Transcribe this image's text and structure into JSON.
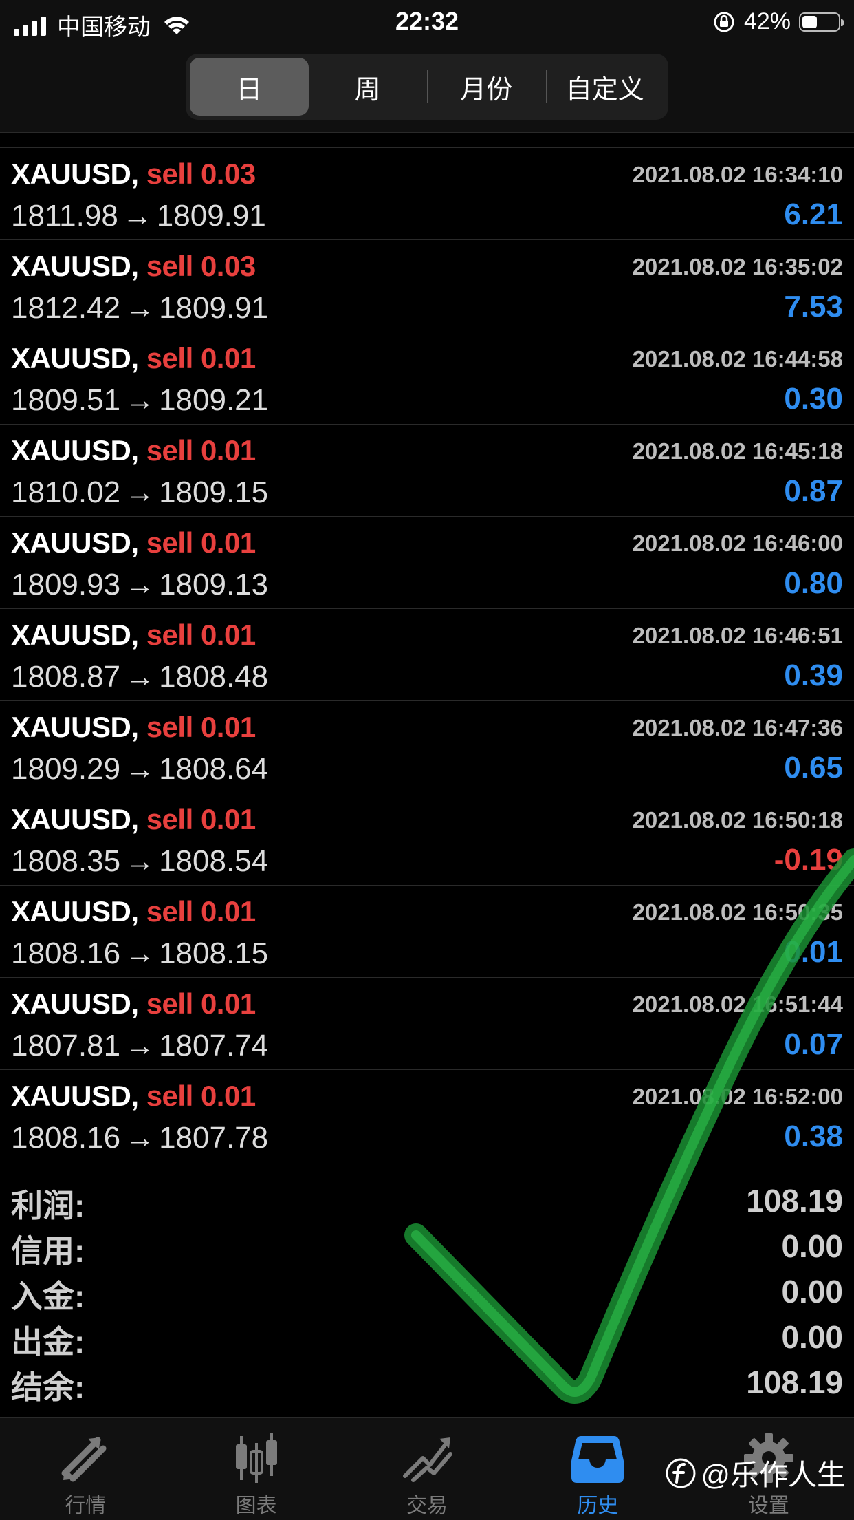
{
  "status_bar": {
    "carrier": "中国移动",
    "time": "22:32",
    "battery_percent": "42%",
    "battery_level": 0.42
  },
  "header": {
    "tabs": [
      {
        "label": "日",
        "active": true
      },
      {
        "label": "周",
        "active": false
      },
      {
        "label": "月份",
        "active": false
      },
      {
        "label": "自定义",
        "active": false
      }
    ]
  },
  "deals": [
    {
      "symbol": "XAUUSD,",
      "side": "sell",
      "volume": "0.03",
      "time": "2021.08.02 16:34:10",
      "open": "1811.98",
      "close": "1809.91",
      "profit": "6.21"
    },
    {
      "symbol": "XAUUSD,",
      "side": "sell",
      "volume": "0.03",
      "time": "2021.08.02 16:35:02",
      "open": "1812.42",
      "close": "1809.91",
      "profit": "7.53"
    },
    {
      "symbol": "XAUUSD,",
      "side": "sell",
      "volume": "0.01",
      "time": "2021.08.02 16:44:58",
      "open": "1809.51",
      "close": "1809.21",
      "profit": "0.30"
    },
    {
      "symbol": "XAUUSD,",
      "side": "sell",
      "volume": "0.01",
      "time": "2021.08.02 16:45:18",
      "open": "1810.02",
      "close": "1809.15",
      "profit": "0.87"
    },
    {
      "symbol": "XAUUSD,",
      "side": "sell",
      "volume": "0.01",
      "time": "2021.08.02 16:46:00",
      "open": "1809.93",
      "close": "1809.13",
      "profit": "0.80"
    },
    {
      "symbol": "XAUUSD,",
      "side": "sell",
      "volume": "0.01",
      "time": "2021.08.02 16:46:51",
      "open": "1808.87",
      "close": "1808.48",
      "profit": "0.39"
    },
    {
      "symbol": "XAUUSD,",
      "side": "sell",
      "volume": "0.01",
      "time": "2021.08.02 16:47:36",
      "open": "1809.29",
      "close": "1808.64",
      "profit": "0.65"
    },
    {
      "symbol": "XAUUSD,",
      "side": "sell",
      "volume": "0.01",
      "time": "2021.08.02 16:50:18",
      "open": "1808.35",
      "close": "1808.54",
      "profit": "-0.19"
    },
    {
      "symbol": "XAUUSD,",
      "side": "sell",
      "volume": "0.01",
      "time": "2021.08.02 16:50:35",
      "open": "1808.16",
      "close": "1808.15",
      "profit": "0.01"
    },
    {
      "symbol": "XAUUSD,",
      "side": "sell",
      "volume": "0.01",
      "time": "2021.08.02 16:51:44",
      "open": "1807.81",
      "close": "1807.74",
      "profit": "0.07"
    },
    {
      "symbol": "XAUUSD,",
      "side": "sell",
      "volume": "0.01",
      "time": "2021.08.02 16:52:00",
      "open": "1808.16",
      "close": "1807.78",
      "profit": "0.38"
    }
  ],
  "arrow_glyph": "→",
  "summary": [
    {
      "label": "利润:",
      "value": "108.19"
    },
    {
      "label": "信用:",
      "value": "0.00"
    },
    {
      "label": "入金:",
      "value": "0.00"
    },
    {
      "label": "出金:",
      "value": "0.00"
    },
    {
      "label": "结余:",
      "value": "108.19"
    }
  ],
  "tabbar": [
    {
      "label": "行情",
      "icon": "quotes-arrows-icon",
      "active": false
    },
    {
      "label": "图表",
      "icon": "candlestick-chart-icon",
      "active": false
    },
    {
      "label": "交易",
      "icon": "trade-chart-icon",
      "active": false
    },
    {
      "label": "历史",
      "icon": "history-inbox-icon",
      "active": true
    },
    {
      "label": "设置",
      "icon": "settings-gear-icon",
      "active": false
    }
  ],
  "watermark": {
    "text": "@乐作人生"
  },
  "colors": {
    "profit_positive": "#2f8df0",
    "profit_negative": "#e8403e",
    "sell": "#e8403e",
    "tab_active": "#2f8df0",
    "checkmark": "#1fa83a"
  }
}
